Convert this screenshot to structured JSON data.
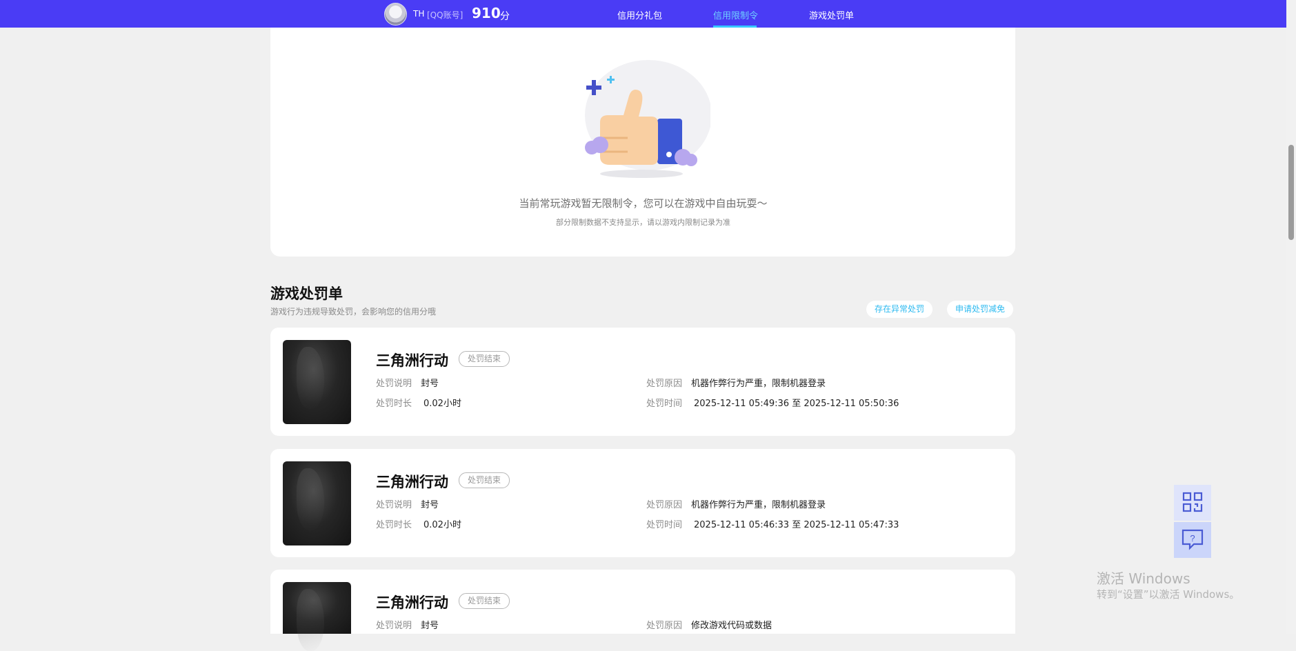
{
  "header": {
    "username": "TH",
    "account_type": "[QQ账号]",
    "score": "910",
    "score_unit": "分",
    "nav": [
      {
        "label": "信用分礼包",
        "active": false
      },
      {
        "label": "信用限制令",
        "active": true
      },
      {
        "label": "游戏处罚单",
        "active": false
      }
    ]
  },
  "restriction": {
    "empty_message": "当前常玩游戏暂无限制令，您可以在游戏中自由玩耍～",
    "empty_note": "部分限制数据不支持显示，请以游戏内限制记录为准"
  },
  "punishments": {
    "title": "游戏处罚单",
    "subtitle": "游戏行为违规导致处罚，会影响您的信用分哦",
    "actions": [
      "存在异常处罚",
      "申请处罚减免"
    ],
    "labels": {
      "desc": "处罚说明",
      "duration": "处罚时长",
      "reason": "处罚原因",
      "time": "处罚时间"
    },
    "items": [
      {
        "game": "三角洲行动",
        "status": "处罚结束",
        "desc": "封号",
        "duration": "0.02小时",
        "reason": "机器作弊行为严重，限制机器登录",
        "time": "2025-12-11 05:49:36 至 2025-12-11 05:50:36"
      },
      {
        "game": "三角洲行动",
        "status": "处罚结束",
        "desc": "封号",
        "duration": "0.02小时",
        "reason": "机器作弊行为严重，限制机器登录",
        "time": "2025-12-11 05:46:33 至 2025-12-11 05:47:33"
      },
      {
        "game": "三角洲行动",
        "status": "处罚结束",
        "desc": "封号",
        "duration": "",
        "reason": "修改游戏代码或数据",
        "time": ""
      }
    ]
  },
  "watermark": {
    "line1": "激活 Windows",
    "line2": "转到“设置”以激活 Windows。"
  },
  "icons": [
    "avatar",
    "qr-code-icon",
    "feedback-icon"
  ],
  "colors": {
    "nav_bg": "#4a3cf5",
    "active_tab": "#6fd0ff",
    "accent_pill_text": "#2dbaf0"
  }
}
